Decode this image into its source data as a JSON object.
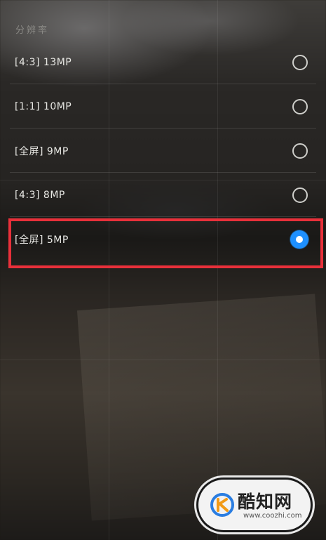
{
  "section": {
    "title": "分辨率"
  },
  "options": [
    {
      "label": "[4:3] 13MP",
      "selected": false
    },
    {
      "label": "[1:1] 10MP",
      "selected": false
    },
    {
      "label": "[全屏] 9MP",
      "selected": false
    },
    {
      "label": "[4:3] 8MP",
      "selected": false
    },
    {
      "label": "[全屏] 5MP",
      "selected": true
    }
  ],
  "colors": {
    "selected_radio": "#1e90ff",
    "highlight_box": "#e8303a"
  },
  "watermark": {
    "name": "酷知网",
    "url": "www.coozhi.com"
  }
}
